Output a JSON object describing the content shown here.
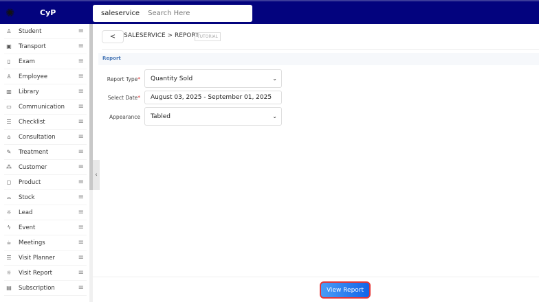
{
  "header": {
    "brand": "CyP",
    "search_module": "saleservice",
    "search_placeholder": "Search Here"
  },
  "sidebar": {
    "items": [
      {
        "label": "Student",
        "icon": "user-icon"
      },
      {
        "label": "Transport",
        "icon": "bus-icon"
      },
      {
        "label": "Exam",
        "icon": "clipboard-icon"
      },
      {
        "label": "Employee",
        "icon": "user-icon"
      },
      {
        "label": "Library",
        "icon": "book-icon"
      },
      {
        "label": "Communication",
        "icon": "message-icon"
      },
      {
        "label": "Checklist",
        "icon": "list-icon"
      },
      {
        "label": "Consultation",
        "icon": "briefcase-icon"
      },
      {
        "label": "Treatment",
        "icon": "pen-icon"
      },
      {
        "label": "Customer",
        "icon": "network-icon"
      },
      {
        "label": "Product",
        "icon": "bag-icon"
      },
      {
        "label": "Stock",
        "icon": "stock-icon"
      },
      {
        "label": "Lead",
        "icon": "bulb-icon"
      },
      {
        "label": "Event",
        "icon": "bolt-icon"
      },
      {
        "label": "Meetings",
        "icon": "cup-icon"
      },
      {
        "label": "Visit Planner",
        "icon": "list-icon"
      },
      {
        "label": "Visit Report",
        "icon": "bulb-icon"
      },
      {
        "label": "Subscription",
        "icon": "card-icon"
      }
    ]
  },
  "breadcrumb": {
    "text": "SALESERVICE > REPORT",
    "tutorial": "TUTORIAL"
  },
  "section": {
    "title": "Report"
  },
  "form": {
    "report_type": {
      "label": "Report Type",
      "value": "Quantity Sold"
    },
    "select_date": {
      "label": "Select Date",
      "value": "August 03, 2025 - September 01, 2025"
    },
    "appearance": {
      "label": "Appearance",
      "value": "Tabled"
    }
  },
  "actions": {
    "view_report": "View Report"
  },
  "colors": {
    "header": "#03037e",
    "button": "#1264e8",
    "highlight": "#e53535"
  }
}
